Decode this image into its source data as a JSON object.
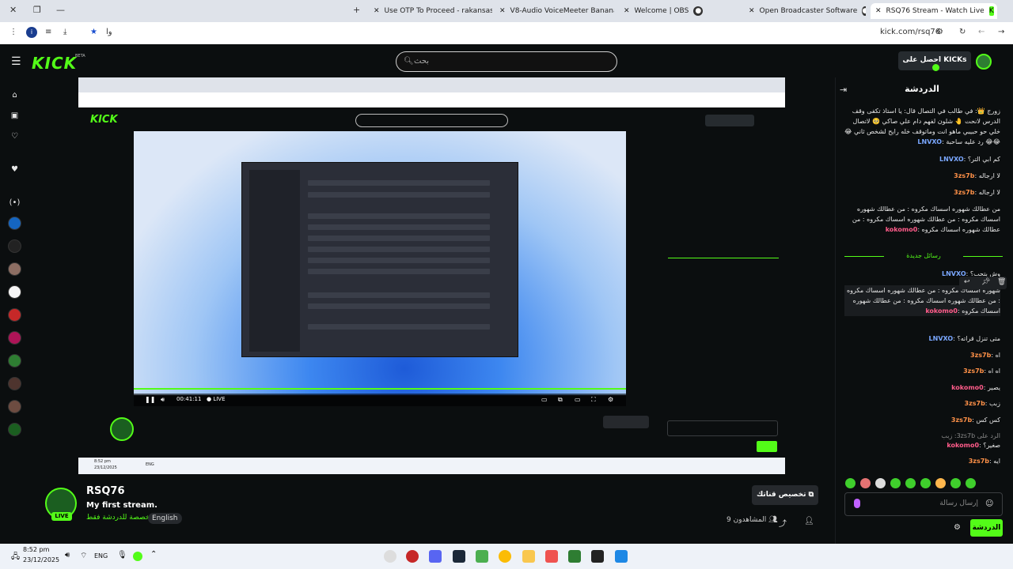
{
  "browser": {
    "tabs": [
      {
        "label": "Use OTP To Proceed - rakansas",
        "icon": "gmail-icon"
      },
      {
        "label": "V8-Audio VoiceMeeter Banana",
        "icon": "voicemeeter-icon"
      },
      {
        "label": "Welcome | OBS",
        "icon": "obs-icon"
      },
      {
        "label": "Open Broadcaster Software",
        "icon": "obs-icon"
      },
      {
        "label": "RSQ76 Stream - Watch Live",
        "icon": "kick-icon",
        "active": true
      }
    ],
    "address_prefix": "ﻭﺍ",
    "url": "kick.com/rsq76"
  },
  "header": {
    "logo": "KICK",
    "beta": "BETA",
    "search_placeholder": "ﺑﺤﺚ",
    "get_kicks": "ﺍﺣﺼﻞ ﻋﻠﻰ KICKs"
  },
  "stream": {
    "time": "00:41:11",
    "live": "LIVE",
    "inner_taskbar_time": "8:52 pm",
    "inner_taskbar_date": "23/12/2025",
    "inner_lang": "ENG"
  },
  "channel": {
    "name": "RSQ76",
    "title": "My first stream.",
    "category": "ﻣﺨﺼﺼﺔ ﻟﻠﺪﺭﺩﺷﺔ ﻓﻘﻂ",
    "language": "English",
    "live_badge": "LIVE",
    "customize": "ﺗﺨﺼﻴﺺ ﻗﻨﺎﺗﻚ",
    "viewers": "9 ﺍﻟﻤﺸﺎﻫﺪﻭﻥ"
  },
  "chat": {
    "title": "ﺍﻟﺪﺭﺩﺷﺔ",
    "messages": [
      {
        "user": "LNVXO",
        "color": "blue",
        "text": "ﺯﻭﺭﺝ 👑: ﻓﻲ ﻃﺎﻟﺐ ﻓﻲ ﺍﻟﺘﺼﺎﻝ ﻗﺎﻝ: ﻳﺎ ﺍﺳﺘﺎﺫ ﺗﻜﻔﻰ ﻭﻗﻒ ﺍﻟﺪﺭﺱ ﻻﻧﺤﺖ 🤚 ﺷﻠﻮﻥ ﻟﻔﻬﻢ ﺩﺍﻡ ﻋﻠﻲ ﺻﺎﻛﻲ 🥺 ﻻﺗﺼﺎﻝ ﺧﻠﻲ ﺣﻮ ﺣﺒﻴﺒﻲ ﻣﺎﻫﻮ ﺍﻧﺖ ﻭﻣﺎﺗﻮﻗﻒ ﺧﻠﻪ ﺭﺍﻳﺢ ﻟﺸﺨﺺ ﺛﺎﻧﻲ 😂😂😂 ﺭﺩ ﻋﻠﻴﻪ ﺳﺎﺣﺒﺔ"
      },
      {
        "user": "LNVXO",
        "color": "blue",
        "text": "ﻛﻢ ﺍﺑﻲ ﺍﻟﺘﺮ؟"
      },
      {
        "user": "3zs7b",
        "color": "orange",
        "text": "ﻻ ﺍﺭﺟﺎﻟﻪ"
      },
      {
        "user": "3zs7b",
        "color": "orange",
        "text": "ﻻ ﺍﺭﺟﺎﻟﻪ"
      },
      {
        "user": "kokomo0",
        "color": "pink",
        "text": "ﻣﻦ ﻋﻄﺎﻟﻚ ﺷﻬﻮﺭﻩ ﺍﺳﺴﺎﻙ ﻣﻜﺮﻭﻩ : ﻣﻦ ﻋﻄﺎﻟﻚ ﺷﻬﻮﺭﻩ ﺍﺳﺴﺎﻙ ﻣﻜﺮﻭﻩ : ﻣﻦ ﻋﻄﺎﻟﻚ ﺷﻬﻮﺭﻩ ﺍﺳﺴﺎﻙ ﻣﻜﺮﻭﻩ : ﻣﻦ ﻋﻄﺎﻟﻚ ﺷﻬﻮﺭﻩ ﺍﺳﺴﺎﻙ ﻣﻜﺮﻭﻩ"
      },
      {
        "user": "LNVXO",
        "color": "blue",
        "text": "ﻭﺵ ﺑﺘﺤﺐ؟"
      },
      {
        "user": "kokomo0",
        "color": "pink",
        "text": "ﺷﻬﻮﺭﻩ ﺍﺳﺴﺎﻙ ﻣﻜﺮﻭﻩ : ﻣﻦ ﻋﻄﺎﻟﻚ ﺷﻬﻮﺭﻩ ﺍﺳﺴﺎﻙ ﻣﻜﺮﻭﻩ : ﻣﻦ ﻋﻄﺎﻟﻚ ﺷﻬﻮﺭﻩ ﺍﺳﺴﺎﻙ ﻣﻜﺮﻭﻩ : ﻣﻦ ﻋﻄﺎﻟﻚ ﺷﻬﻮﺭﻩ ﺍﺳﺴﺎﻙ ﻣﻜﺮﻭﻩ"
      },
      {
        "user": "LNVXO",
        "color": "blue",
        "text": "ﻣﺘﻰ ﺗﻨﺰﻝ ﻗﺮﺍﺗﻪ؟"
      },
      {
        "user": "3zs7b",
        "color": "orange",
        "text": "ﺍﻩ"
      },
      {
        "user": "3zs7b",
        "color": "orange",
        "text": "ﺍﻩ ﺍﻩ"
      },
      {
        "user": "kokomo0",
        "color": "pink",
        "text": "ﻳﺼﻴﺮ"
      },
      {
        "user": "3zs7b",
        "color": "orange",
        "text": "ﺯﺑﺐ"
      },
      {
        "user": "3zs7b",
        "color": "orange",
        "text": "ﻛﺲ ﻛﺲ"
      },
      {
        "user": "kokomo0",
        "color": "pink",
        "text": "ﺻﻐﻴﺮ؟"
      },
      {
        "user": "3zs7b",
        "color": "orange",
        "text": "ﺍﻳﻪ"
      }
    ],
    "new_messages": "ﺭﺳﺎﺋﻞ ﺟﺪﻳﺪﺓ",
    "reply_to": "ﺍﻟﺮﺩ ﻋﻠﻰ 3zs7b: ﺯﺑﺐ",
    "input_placeholder": "ﺇﺭﺳﺎﻝ ﺭﺳﺎﻟﺔ",
    "send_label": "ﺍﻟﺪﺭﺩﺷﺔ"
  },
  "taskbar": {
    "time": "8:52 pm",
    "date": "23/12/2025",
    "lang": "ENG"
  }
}
